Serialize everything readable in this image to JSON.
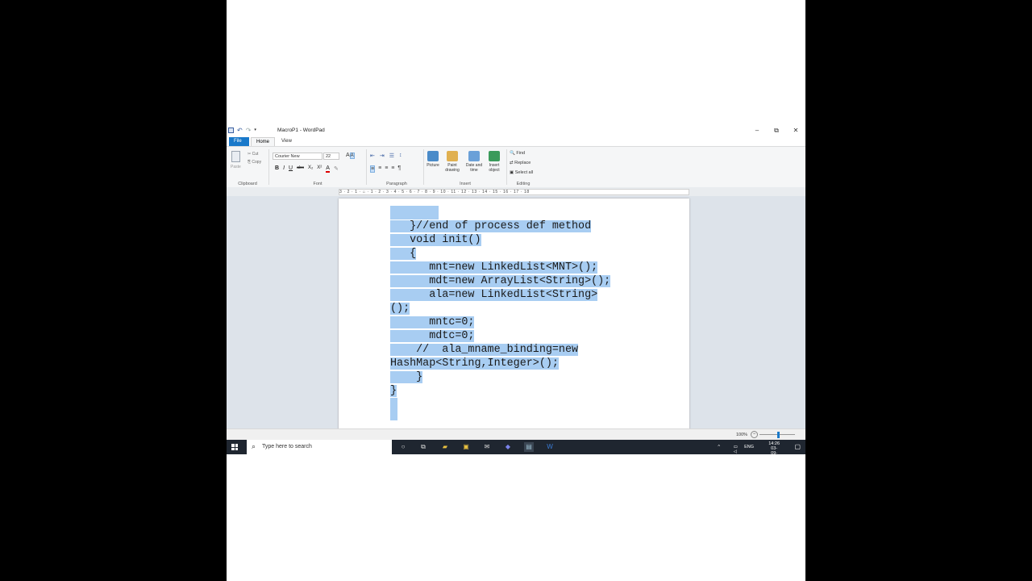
{
  "window": {
    "title": "MacroP1 - WordPad",
    "controls": {
      "minimize": "–",
      "restore": "⧉",
      "close": "✕"
    }
  },
  "ribbon": {
    "tabs": {
      "file": "File",
      "home": "Home",
      "view": "View"
    },
    "clipboard": {
      "paste": "Paste",
      "cut": "Cut",
      "copy": "Copy",
      "label": "Clipboard"
    },
    "font": {
      "family": "Courier New",
      "size": "22",
      "label": "Font"
    },
    "paragraph": {
      "label": "Paragraph"
    },
    "insert": {
      "label": "Insert",
      "picture": "Picture",
      "paint_drawing": "Paint drawing",
      "date_time": "Date and time",
      "insert_object": "Insert object"
    },
    "editing": {
      "label": "Editing",
      "find": "Find",
      "replace": "Replace",
      "select_all": "Select all"
    }
  },
  "ruler": {
    "marks": "3 · 2 · 1 · ⌂ · 1 · 2 · 3 · 4 · 5 · 6 · 7 · 8 · 9 · 10 · 11 · 12 · 13 · 14 · 15 · 16 · 17 · 18"
  },
  "document": {
    "lines": [
      "",
      "   }//end of process def method",
      "   void init()",
      "   {",
      "      mnt=new LinkedList<MNT>();",
      "      mdt=new ArrayList<String>();",
      "      ala=new LinkedList<String>",
      "();",
      "      mntc=0;",
      "      mdtc=0;",
      "    //  ala_mname_binding=new",
      "HashMap<String,Integer>();",
      "    }",
      "}",
      ""
    ]
  },
  "status": {
    "zoom": "100%",
    "zoom_level_percent": 100
  },
  "taskbar": {
    "search_placeholder": "Type here to search",
    "lang": "ENG",
    "time": "14:26",
    "date": "03-09-2021"
  },
  "colors": {
    "selection": "#a8cdf2",
    "accent": "#1979ca",
    "taskbar": "#1f2630"
  }
}
